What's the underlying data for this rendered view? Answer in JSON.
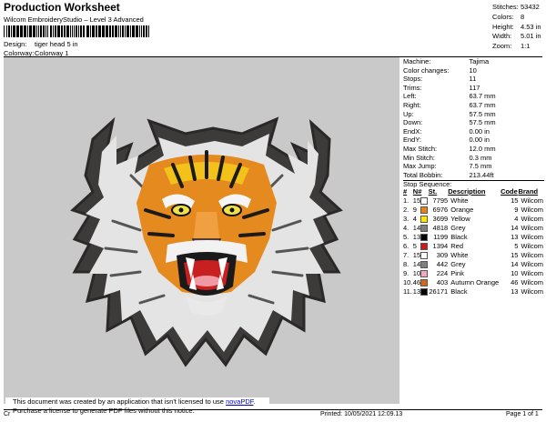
{
  "header": {
    "title": "Production Worksheet",
    "subtitle": "Wilcom EmbroideryStudio – Level 3 Advanced",
    "design_label": "Design:",
    "design_value": "tiger head 5 in",
    "colorway_label": "Colorway:",
    "colorway_value": "Colorway 1"
  },
  "summary": [
    {
      "label": "Stitches:",
      "value": "53432"
    },
    {
      "label": "Colors:",
      "value": "8"
    },
    {
      "label": "Height:",
      "value": "4.53 in"
    },
    {
      "label": "Width:",
      "value": "5.01 in"
    },
    {
      "label": "Zoom:",
      "value": "1:1"
    }
  ],
  "params": [
    {
      "label": "Machine:",
      "value": "Tajima"
    },
    {
      "label": "Color changes:",
      "value": "10"
    },
    {
      "label": "Stops:",
      "value": "11"
    },
    {
      "label": "Trims:",
      "value": "117"
    },
    {
      "label": "Left:",
      "value": "63.7 mm"
    },
    {
      "label": "Right:",
      "value": "63.7 mm"
    },
    {
      "label": "Up:",
      "value": "57.5 mm"
    },
    {
      "label": "Down:",
      "value": "57.5 mm"
    },
    {
      "label": "EndX:",
      "value": "0.00 in"
    },
    {
      "label": "EndY:",
      "value": "0.00 in"
    },
    {
      "label": "Max Stitch:",
      "value": "12.0 mm"
    },
    {
      "label": "Min Stitch:",
      "value": "0.3 mm"
    },
    {
      "label": "Max Jump:",
      "value": "7.5 mm"
    },
    {
      "label": "Total Bobbin:",
      "value": "213.44ft"
    }
  ],
  "stop_sequence": {
    "title": "Stop Sequence:",
    "headers": [
      "#",
      "N#",
      "St.",
      "Description",
      "Code",
      "Brand"
    ],
    "rows": [
      {
        "num": "1.",
        "n": "15",
        "color": "#ffffff",
        "st": "7795",
        "desc": "White",
        "code": "15",
        "brand": "Wilcom"
      },
      {
        "num": "2.",
        "n": "9",
        "color": "#e8801c",
        "st": "6976",
        "desc": "Orange",
        "code": "9",
        "brand": "Wilcom"
      },
      {
        "num": "3.",
        "n": "4",
        "color": "#ffe600",
        "st": "3699",
        "desc": "Yellow",
        "code": "4",
        "brand": "Wilcom"
      },
      {
        "num": "4.",
        "n": "14",
        "color": "#7f7f7f",
        "st": "4818",
        "desc": "Grey",
        "code": "14",
        "brand": "Wilcom"
      },
      {
        "num": "5.",
        "n": "13",
        "color": "#000000",
        "st": "1199",
        "desc": "Black",
        "code": "13",
        "brand": "Wilcom"
      },
      {
        "num": "6.",
        "n": "5",
        "color": "#d01818",
        "st": "1394",
        "desc": "Red",
        "code": "5",
        "brand": "Wilcom"
      },
      {
        "num": "7.",
        "n": "15",
        "color": "#ffffff",
        "st": "309",
        "desc": "White",
        "code": "15",
        "brand": "Wilcom"
      },
      {
        "num": "8.",
        "n": "14",
        "color": "#7f7f7f",
        "st": "442",
        "desc": "Grey",
        "code": "14",
        "brand": "Wilcom"
      },
      {
        "num": "9.",
        "n": "10",
        "color": "#f4a8c0",
        "st": "224",
        "desc": "Pink",
        "code": "10",
        "brand": "Wilcom"
      },
      {
        "num": "10.",
        "n": "46",
        "color": "#d8661a",
        "st": "403",
        "desc": "Autumn Orange",
        "code": "46",
        "brand": "Wilcom"
      },
      {
        "num": "11.",
        "n": "13",
        "color": "#000000",
        "st": "26171",
        "desc": "Black",
        "code": "13",
        "brand": "Wilcom"
      }
    ]
  },
  "notice": {
    "line1_prefix": "This document was created by an application that isn't licensed to use ",
    "link": "novaPDF",
    "line1_suffix": ".",
    "line2": "Purchase a license to generate PDF files without this notice."
  },
  "footer": {
    "cr": "Cr",
    "printed": "Printed: 10/05/2021 12:09.13",
    "page": "Page 1 of 1"
  }
}
